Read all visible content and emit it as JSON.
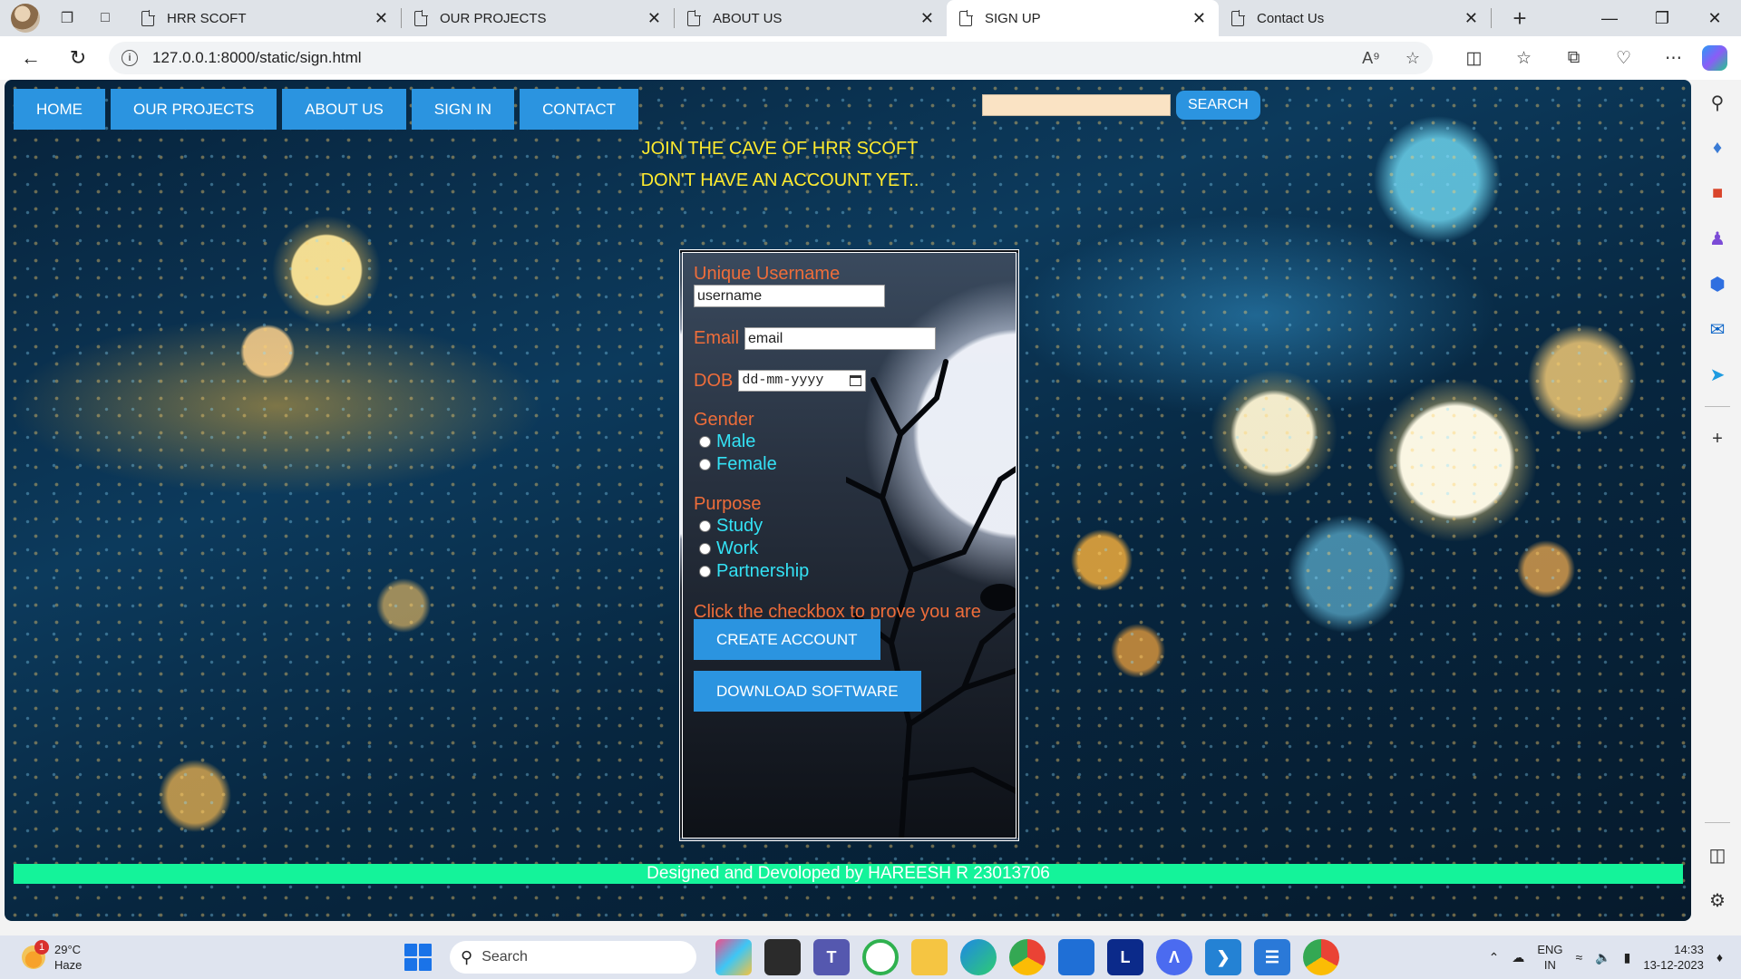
{
  "browser": {
    "tabs": [
      {
        "label": "HRR SCOFT",
        "active": false
      },
      {
        "label": "OUR PROJECTS",
        "active": false
      },
      {
        "label": "ABOUT US",
        "active": false
      },
      {
        "label": "SIGN UP",
        "active": true
      },
      {
        "label": "Contact Us",
        "active": false
      }
    ],
    "url": "127.0.0.1:8000/static/sign.html"
  },
  "page": {
    "nav": [
      "HOME",
      "OUR PROJECTS",
      "ABOUT US",
      "SIGN IN",
      "CONTACT"
    ],
    "search_button": "SEARCH",
    "headline1": "JOIN THE CAVE OF HRR SCOFT",
    "headline2": "DON'T HAVE AN ACCOUNT YET..",
    "form": {
      "username_label": "Unique Username",
      "username_value": "username",
      "email_label": "Email",
      "email_value": "email",
      "dob_label": "DOB",
      "dob_placeholder": "dd-mm-yyyy",
      "gender_label": "Gender",
      "gender_options": [
        "Male",
        "Female"
      ],
      "purpose_label": "Purpose",
      "purpose_options": [
        "Study",
        "Work",
        "Partnership"
      ],
      "human_label": "Click the checkbox to prove you are human",
      "create_button": "CREATE ACCOUNT",
      "download_button": "DOWNLOAD SOFTWARE"
    },
    "footer": "Designed and Devoloped by HAREESH R 23013706"
  },
  "taskbar": {
    "weather_temp": "29°C",
    "weather_desc": "Haze",
    "weather_badge": "1",
    "search_placeholder": "Search",
    "lang_line1": "ENG",
    "lang_line2": "IN",
    "time": "14:33",
    "date": "13-12-2023"
  },
  "colors": {
    "nav_button": "#2b94e0",
    "headline": "#ffea2e",
    "form_label": "#ef6d3a",
    "form_option": "#34e2f5",
    "footer_bar": "#14f39a",
    "search_field": "#fae3c4"
  }
}
